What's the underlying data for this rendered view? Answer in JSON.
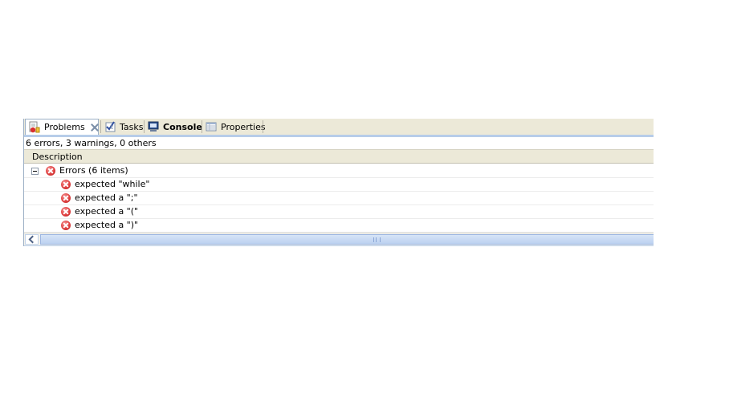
{
  "tabs": [
    {
      "label": "Problems",
      "icon": "problems-icon",
      "active": true,
      "closable": true
    },
    {
      "label": "Tasks",
      "icon": "tasks-icon",
      "active": false
    },
    {
      "label": "Console",
      "icon": "console-icon",
      "active": false,
      "bold": true
    },
    {
      "label": "Properties",
      "icon": "properties-icon",
      "active": false
    }
  ],
  "status": "6 errors, 3 warnings, 0 others",
  "columns": [
    "Description"
  ],
  "tree": {
    "group_label": "Errors (6 items)",
    "group_icon": "error-icon",
    "expanded": true,
    "items": [
      "expected \"while\"",
      "expected a \";\"",
      "expected a \"(\"",
      "expected a \")\""
    ]
  },
  "colors": {
    "tab_background": "#ece9d8",
    "accent_border": "#b7cde9",
    "error_red": "#e04040"
  }
}
